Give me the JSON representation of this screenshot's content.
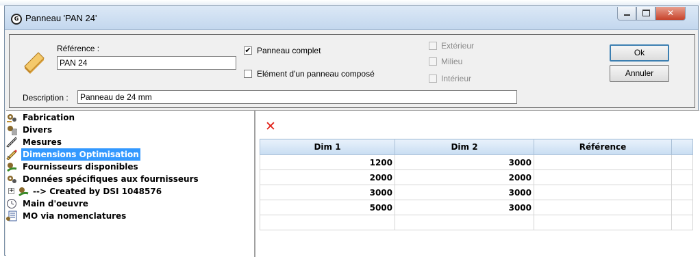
{
  "window": {
    "title": "Panneau 'PAN 24'"
  },
  "form": {
    "reference_label": "Référence :",
    "reference_value": "PAN 24",
    "description_label": "Description :",
    "description_value": "Panneau de 24 mm",
    "panneau_complet": {
      "label": "Panneau complet",
      "checked": true
    },
    "element_compose": {
      "label": "Elément d'un panneau composé",
      "checked": false
    },
    "position_options": [
      {
        "label": "Extérieur",
        "enabled": false
      },
      {
        "label": "Milieu",
        "enabled": false
      },
      {
        "label": "Intérieur",
        "enabled": false
      }
    ],
    "ok_label": "Ok",
    "cancel_label": "Annuler"
  },
  "tree": {
    "items": [
      {
        "label": "Fabrication",
        "icon": "gears-icon"
      },
      {
        "label": "Divers",
        "icon": "gears-list-icon"
      },
      {
        "label": "Mesures",
        "icon": "ruler-icon"
      },
      {
        "label": "Dimensions Optimisation",
        "icon": "pencil-ruler-icon",
        "selected": true
      },
      {
        "label": "Fournisseurs disponibles",
        "icon": "supplier-icon"
      },
      {
        "label": "Données spécifiques aux fournisseurs",
        "icon": "gears-icon"
      },
      {
        "label": "--> Created by DSI 1048576",
        "icon": "supplier-icon",
        "expandable": true
      },
      {
        "label": "Main d'oeuvre",
        "icon": "clock-icon"
      },
      {
        "label": "MO via nomenclatures",
        "icon": "list-icon"
      }
    ]
  },
  "grid": {
    "columns": [
      "Dim 1",
      "Dim 2",
      "Référence"
    ],
    "rows": [
      [
        "1200",
        "3000",
        ""
      ],
      [
        "2000",
        "2000",
        ""
      ],
      [
        "3000",
        "3000",
        ""
      ],
      [
        "5000",
        "3000",
        ""
      ],
      [
        "",
        "",
        ""
      ]
    ]
  },
  "colors": {
    "selection": "#3399ff",
    "delete": "#e2231a"
  }
}
